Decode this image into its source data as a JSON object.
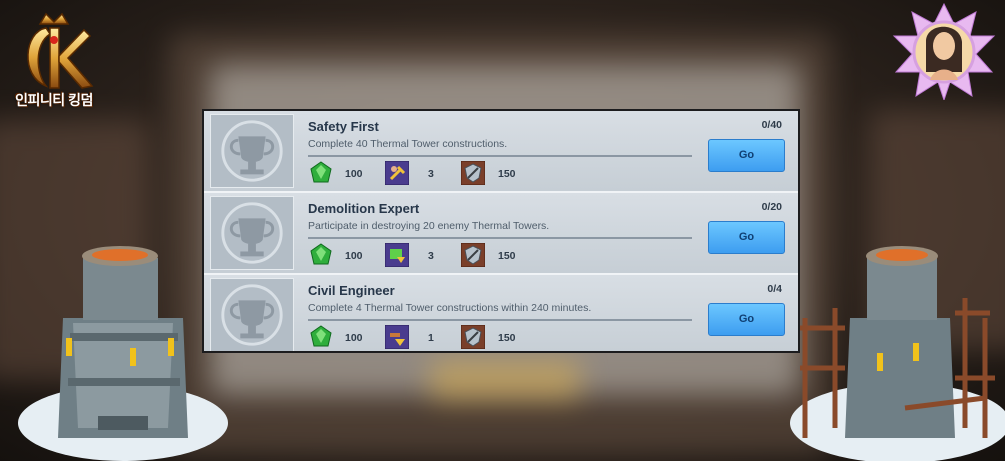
{
  "brand": {
    "logo_text": "인피니티 킹덤"
  },
  "colors": {
    "button": "#3d9df0",
    "panel": "#c4ccd3",
    "title": "#27374a",
    "gem": "#3db84a"
  },
  "achievements": [
    {
      "title": "Safety First",
      "description": "Complete 40 Thermal Tower constructions.",
      "progress_text": "0/40",
      "progress": 0,
      "button_label": "Go",
      "rewards": [
        {
          "icon": "emerald-gem-icon",
          "value": "100"
        },
        {
          "icon": "builder-hammer-icon",
          "value": "3"
        },
        {
          "icon": "shield-crest-icon",
          "value": "150"
        }
      ]
    },
    {
      "title": "Demolition Expert",
      "description": "Participate in destroying 20 enemy Thermal Towers.",
      "progress_text": "0/20",
      "progress": 0,
      "button_label": "Go",
      "rewards": [
        {
          "icon": "emerald-gem-icon",
          "value": "100"
        },
        {
          "icon": "scroll-speedup-icon",
          "value": "3"
        },
        {
          "icon": "shield-crest-icon",
          "value": "150"
        }
      ]
    },
    {
      "title": "Civil Engineer",
      "description": "Complete 4 Thermal Tower constructions within 240 minutes.",
      "progress_text": "0/4",
      "progress": 0,
      "button_label": "Go",
      "rewards": [
        {
          "icon": "emerald-gem-icon",
          "value": "100"
        },
        {
          "icon": "hammer-speedup-icon",
          "value": "1"
        },
        {
          "icon": "shield-crest-icon",
          "value": "150"
        }
      ]
    }
  ]
}
